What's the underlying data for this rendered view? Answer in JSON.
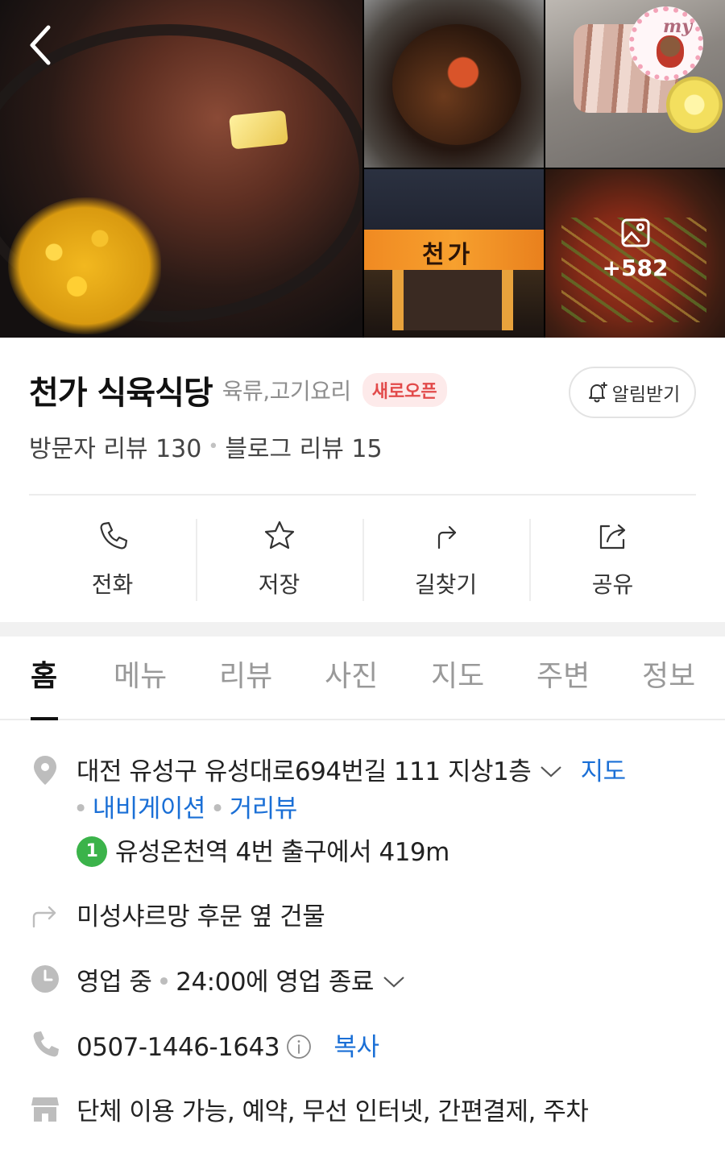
{
  "gallery": {
    "more_count": "+582",
    "storefront_sign": "천가",
    "sticker_text": "my"
  },
  "place": {
    "name": "천가 식육식당",
    "category": "육류,고기요리",
    "badge": "새로오픈",
    "alarm_label": "알림받기",
    "visitor_reviews": "방문자 리뷰 130",
    "blog_reviews": "블로그 리뷰 15"
  },
  "actions": [
    {
      "label": "전화",
      "icon": "phone-icon"
    },
    {
      "label": "저장",
      "icon": "star-icon"
    },
    {
      "label": "길찾기",
      "icon": "directions-icon"
    },
    {
      "label": "공유",
      "icon": "share-icon"
    }
  ],
  "tabs": [
    "홈",
    "메뉴",
    "리뷰",
    "사진",
    "지도",
    "주변",
    "정보"
  ],
  "info": {
    "address": "대전 유성구 유성대로694번길 111 지상1층",
    "map_link": "지도",
    "navigation_link": "내비게이션",
    "streetview_link": "거리뷰",
    "station_line": "1",
    "station_text": "유성온천역 4번 출구에서 419m",
    "directions_hint": "미성샤르망 후문 옆 건물",
    "hours_status": "영업 중",
    "hours_detail": "24:00에 영업 종료",
    "phone": "0507-1446-1643",
    "copy_label": "복사",
    "amenities": "단체 이용 가능, 예약, 무선 인터넷, 간편결제, 주차"
  },
  "colors": {
    "accent_blue": "#1a6fd6",
    "badge_red": "#e24a4a",
    "station_green": "#3bb34a"
  }
}
